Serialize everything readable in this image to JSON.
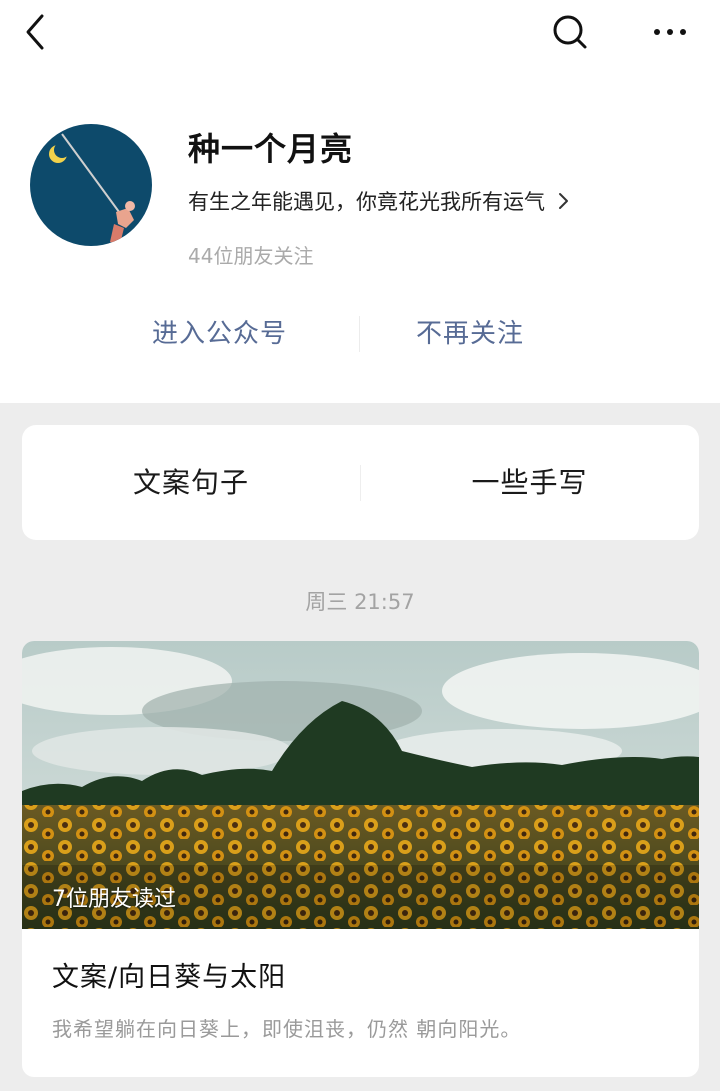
{
  "header": {
    "back_icon": "chevron-left-icon",
    "search_icon": "search-icon",
    "more_icon": "more-horizontal-icon"
  },
  "profile": {
    "name": "种一个月亮",
    "bio": "有生之年能遇见，你竟花光我所有运气",
    "followers": "44位朋友关注",
    "avatar_bg": "#0d4a6b"
  },
  "actions": {
    "enter_label": "进入公众号",
    "unfollow_label": "不再关注",
    "link_color": "#576b95"
  },
  "menu": {
    "items": [
      "文案句子",
      "一些手写"
    ]
  },
  "feed": {
    "timestamp": "周三 21:57",
    "article": {
      "read_count": "7位朋友读过",
      "title": "文案/向日葵与太阳",
      "summary": "我希望躺在向日葵上，即使沮丧，仍然 朝向阳光。"
    }
  }
}
